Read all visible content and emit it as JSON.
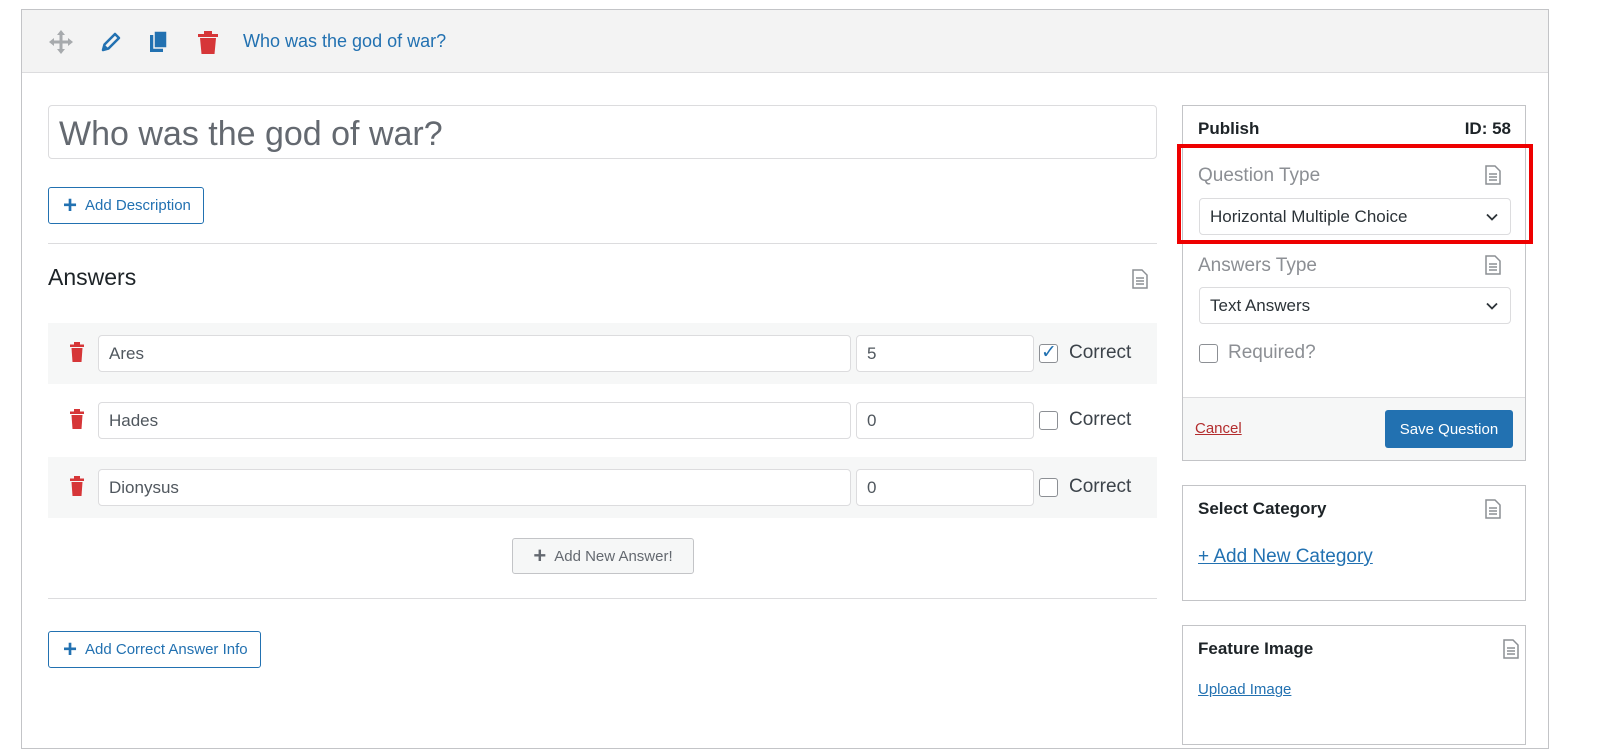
{
  "header": {
    "title": "Who was the god of war?",
    "icons": [
      "move-icon",
      "pencil-icon",
      "copy-icon",
      "trash-icon"
    ]
  },
  "question": {
    "title": "Who was the god of war?",
    "add_description_label": "Add Description"
  },
  "answers": {
    "heading": "Answers",
    "correct_label": "Correct",
    "add_new_label": "Add New Answer!",
    "items": [
      {
        "text": "Ares",
        "points": "5",
        "correct": true
      },
      {
        "text": "Hades",
        "points": "0",
        "correct": false
      },
      {
        "text": "Dionysus",
        "points": "0",
        "correct": false
      }
    ]
  },
  "add_correct_info_label": "Add Correct Answer Info",
  "publish": {
    "title": "Publish",
    "id_label": "ID: 58",
    "question_type_label": "Question Type",
    "question_type_value": "Horizontal Multiple Choice",
    "answers_type_label": "Answers Type",
    "answers_type_value": "Text Answers",
    "required_label": "Required?",
    "required_checked": false,
    "cancel_label": "Cancel",
    "save_label": "Save Question"
  },
  "category": {
    "title": "Select Category",
    "add_label": "+ Add New Category"
  },
  "feature_image": {
    "title": "Feature Image",
    "upload_label": "Upload Image"
  },
  "colors": {
    "accent": "#2271b1",
    "danger": "#d63638",
    "highlight": "#ee0000"
  }
}
